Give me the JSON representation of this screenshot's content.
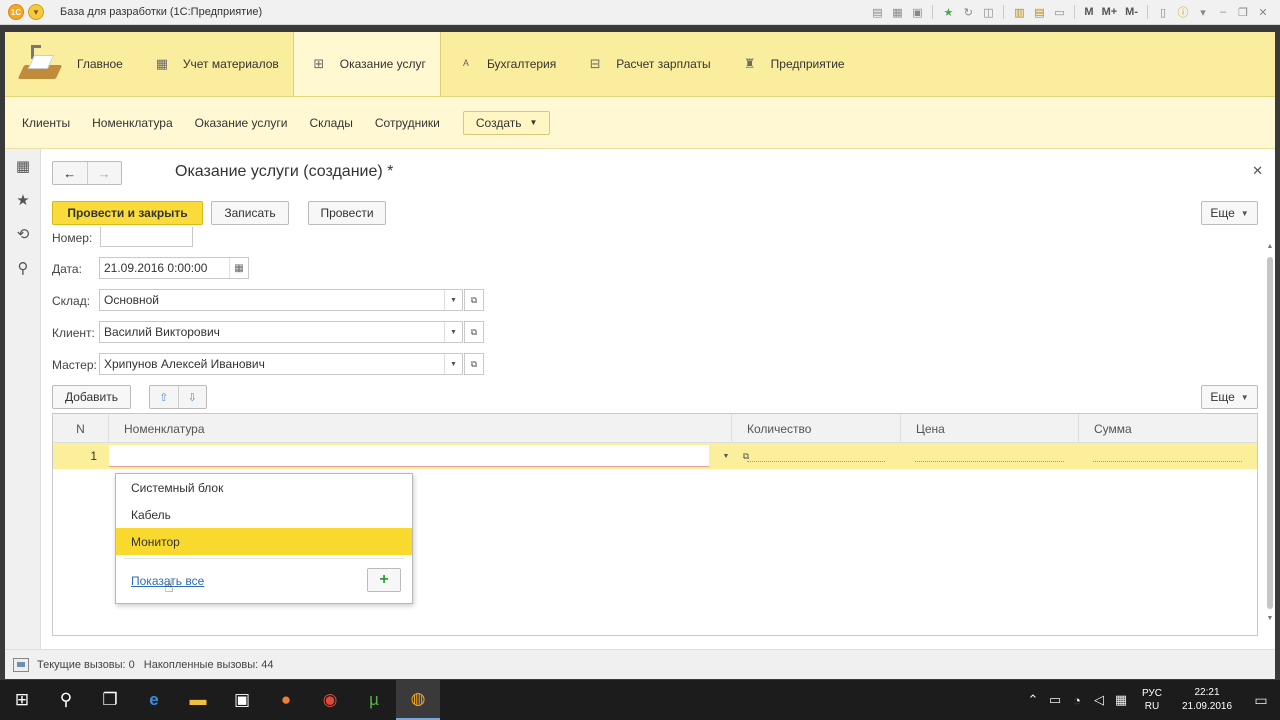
{
  "window": {
    "title": "База для разработки  (1С:Предприятие)",
    "toolbar_m1": "M",
    "toolbar_m2": "M+",
    "toolbar_m3": "M-"
  },
  "sections": [
    {
      "label": "Главное",
      "icon": "home-icon"
    },
    {
      "label": "Учет материалов",
      "icon": "table-icon"
    },
    {
      "label": "Оказание услуг",
      "icon": "service-icon"
    },
    {
      "label": "Бухгалтерия",
      "icon": "accounting-icon"
    },
    {
      "label": "Расчет зарплаты",
      "icon": "salary-icon"
    },
    {
      "label": "Предприятие",
      "icon": "enterprise-icon"
    }
  ],
  "nav": {
    "links": [
      "Клиенты",
      "Номенклатура",
      "Оказание услуги",
      "Склады",
      "Сотрудники"
    ],
    "create_label": "Создать"
  },
  "form": {
    "title": "Оказание услуги (создание) *",
    "btn_post_close": "Провести и закрыть",
    "btn_save": "Записать",
    "btn_post": "Провести",
    "btn_more": "Еще",
    "label_number": "Номер:",
    "label_date": "Дата:",
    "date_value": "21.09.2016  0:00:00",
    "label_warehouse": "Склад:",
    "warehouse_value": "Основной",
    "label_client": "Клиент:",
    "client_value": "Василий Викторович",
    "label_master": "Мастер:",
    "master_value": "Хрипунов Алексей Иванович",
    "btn_add": "Добавить",
    "btn_more_table": "Еще"
  },
  "table": {
    "columns": [
      "N",
      "Номенклатура",
      "Количество",
      "Цена",
      "Сумма"
    ],
    "rows": [
      {
        "n": "1"
      }
    ]
  },
  "dropdown": {
    "items": [
      "Системный блок",
      "Кабель",
      "Монитор"
    ],
    "selected": "Монитор",
    "show_all": "Показать все"
  },
  "status": {
    "current_calls": "Текущие вызовы: 0",
    "accumulated_calls": "Накопленные вызовы: 44"
  },
  "taskbar": {
    "lang_top": "РУС",
    "lang_bottom": "RU",
    "time": "22:21",
    "date": "21.09.2016"
  },
  "colors": {
    "accent_yellow": "#f9dc3a",
    "section_bg": "#fbed9e",
    "navbar_bg": "#fff8d2",
    "selected_row": "#fbef9c"
  }
}
